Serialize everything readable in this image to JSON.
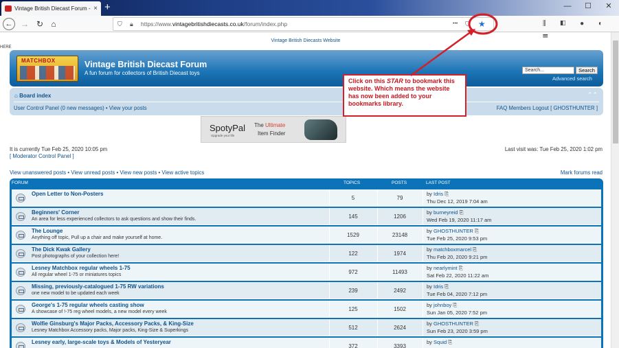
{
  "browser": {
    "tab_title": "Vintage British Diecast Forum - ",
    "tab_close": "×",
    "new_tab": "+",
    "url_prefix": "https://www.",
    "url_domain": "vintagebritishdiecasts.co.uk",
    "url_path": "/forum/index.php",
    "more": "•••",
    "win_min": "—",
    "win_max": "☐",
    "win_close": "✕",
    "tools": "⫼ ◧ ● ◐ ☰"
  },
  "page": {
    "here": "HERE",
    "top_link": "Vintage British Diecasts Website",
    "site_title": "Vintage British Diecast Forum",
    "site_desc": "A fun forum for collectors of British Diecast toys",
    "logo_text": "MATCHBOX",
    "search_placeholder": "Search...",
    "search_button": "Search",
    "advanced_search": "Advanced search",
    "board_index": "Board index",
    "ucp": "User Control Panel (0 new messages) • View your posts",
    "right_links": "FAQ  Members  Logout [ GHOSTHUNTER ]",
    "current_time": "It is currently Tue Feb 25, 2020 10:05 pm",
    "moderator_cp": "[ Moderator Control Panel ]",
    "last_visit": "Last visit was: Tue Feb 25, 2020 1:02 pm",
    "view_links": "View unanswered posts • View unread posts • View new posts • View active topics",
    "mark_read": "Mark forums read",
    "ad": {
      "brand": "SpotyPal",
      "tag": "Upgrade your life",
      "ultimate_pre": "The ",
      "ultimate": "Ultimate",
      "finder": "Item Finder"
    }
  },
  "table": {
    "headers": {
      "forum": "FORUM",
      "topics": "TOPICS",
      "posts": "POSTS",
      "last_post": "LAST POST"
    },
    "rows": [
      {
        "name": "Open Letter to Non-Posters",
        "desc": "",
        "topics": "5",
        "posts": "79",
        "by": "Idris",
        "date": "Thu Dec 12, 2019 7:04 am"
      },
      {
        "name": "Beginners' Corner",
        "desc": "An area for less experienced collectors to ask questions and show their finds.",
        "topics": "145",
        "posts": "1206",
        "by": "burneyreid",
        "date": "Wed Feb 19, 2020 11:17 am"
      },
      {
        "name": "The Lounge",
        "desc": "Anything off topic, Pull up a chair and make yourself at home.",
        "topics": "1529",
        "posts": "23148",
        "by": "GHOSTHUNTER",
        "date": "Tue Feb 25, 2020 9:53 pm"
      },
      {
        "name": "The Dick Kwak Gallery",
        "desc": "Post photographs of your collection here!",
        "topics": "122",
        "posts": "1974",
        "by": "matchboxmarcel",
        "date": "Thu Feb 20, 2020 9:21 pm"
      },
      {
        "name": "Lesney Matchbox regular wheels 1-75",
        "desc": "All regular wheel 1-75 or miniatures topics",
        "topics": "972",
        "posts": "11493",
        "by": "nearlymint",
        "date": "Sat Feb 22, 2020 11:22 am"
      },
      {
        "name": "Missing, previously-catalogued 1-75 RW variations",
        "desc": "one new model to be updated each week",
        "topics": "239",
        "posts": "2492",
        "by": "Idris",
        "date": "Tue Feb 04, 2020 7:12 pm"
      },
      {
        "name": "George's 1-75 regular wheels casting show",
        "desc": "A showcase of !-75 reg wheel models, a new model every week",
        "topics": "125",
        "posts": "1502",
        "by": "johnboy",
        "date": "Sun Jan 05, 2020 7:52 pm"
      },
      {
        "name": "Wolfie Ginsburg's Major Packs, Accessory Packs, & King-Size",
        "desc": "Lesney Matchbox Accessory packs, Major packs, King-Size & Superkings",
        "topics": "512",
        "posts": "2624",
        "by": "GHOSTHUNTER",
        "date": "Sun Feb 23, 2020 3:59 pm"
      },
      {
        "name": "Lesney early, large-scale toys & Models of Yesteryear",
        "desc": "",
        "topics": "372",
        "posts": "3393",
        "by": "Squid",
        "date": ""
      }
    ],
    "by_prefix": "by "
  },
  "callout": {
    "line1": "Click on this ",
    "star_word": "STAR",
    "line2": " to bookmark this website. Which means the website has now been added to your bookmarks library."
  },
  "colors": {
    "header": "#1b74b5",
    "accent": "#105289",
    "callout": "#d21f2a",
    "star": "#1e6fd8"
  }
}
